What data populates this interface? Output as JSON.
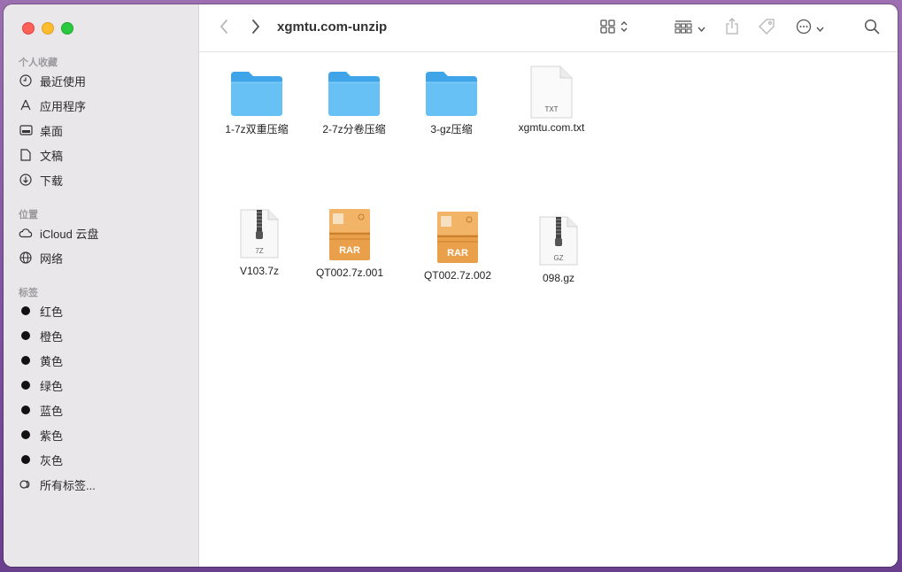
{
  "window": {
    "title": "xgmtu.com-unzip"
  },
  "sidebar": {
    "favorites_header": "个人收藏",
    "favorites": [
      {
        "label": "最近使用",
        "icon": "clock-icon"
      },
      {
        "label": "应用程序",
        "icon": "applications-icon"
      },
      {
        "label": "桌面",
        "icon": "desktop-icon"
      },
      {
        "label": "文稿",
        "icon": "document-icon"
      },
      {
        "label": "下载",
        "icon": "download-icon"
      }
    ],
    "locations_header": "位置",
    "locations": [
      {
        "label": "iCloud 云盘",
        "icon": "cloud-icon"
      },
      {
        "label": "网络",
        "icon": "network-icon"
      }
    ],
    "tags_header": "标签",
    "tags": [
      {
        "label": "红色"
      },
      {
        "label": "橙色"
      },
      {
        "label": "黄色"
      },
      {
        "label": "绿色"
      },
      {
        "label": "蓝色"
      },
      {
        "label": "紫色"
      },
      {
        "label": "灰色"
      }
    ],
    "all_tags": {
      "label": "所有标签...",
      "icon": "all-tags-icon"
    }
  },
  "files": [
    {
      "name": "1-7z双重压缩",
      "type": "folder"
    },
    {
      "name": "2-7z分卷压缩",
      "type": "folder"
    },
    {
      "name": "3-gz压缩",
      "type": "folder"
    },
    {
      "name": "xgmtu.com.txt",
      "type": "txt",
      "badge": "TXT"
    },
    {
      "name": "V103.7z",
      "type": "archive",
      "badge": "7Z"
    },
    {
      "name": "QT002.7z.001",
      "type": "rar",
      "badge": "RAR"
    },
    {
      "name": "QT002.7z.002",
      "type": "rar",
      "badge": "RAR"
    },
    {
      "name": "098.gz",
      "type": "archive",
      "badge": "GZ"
    }
  ],
  "colors": {
    "folder": "#5bb8f0",
    "rar": "#e8a14a",
    "tag_dot": "#111111"
  }
}
